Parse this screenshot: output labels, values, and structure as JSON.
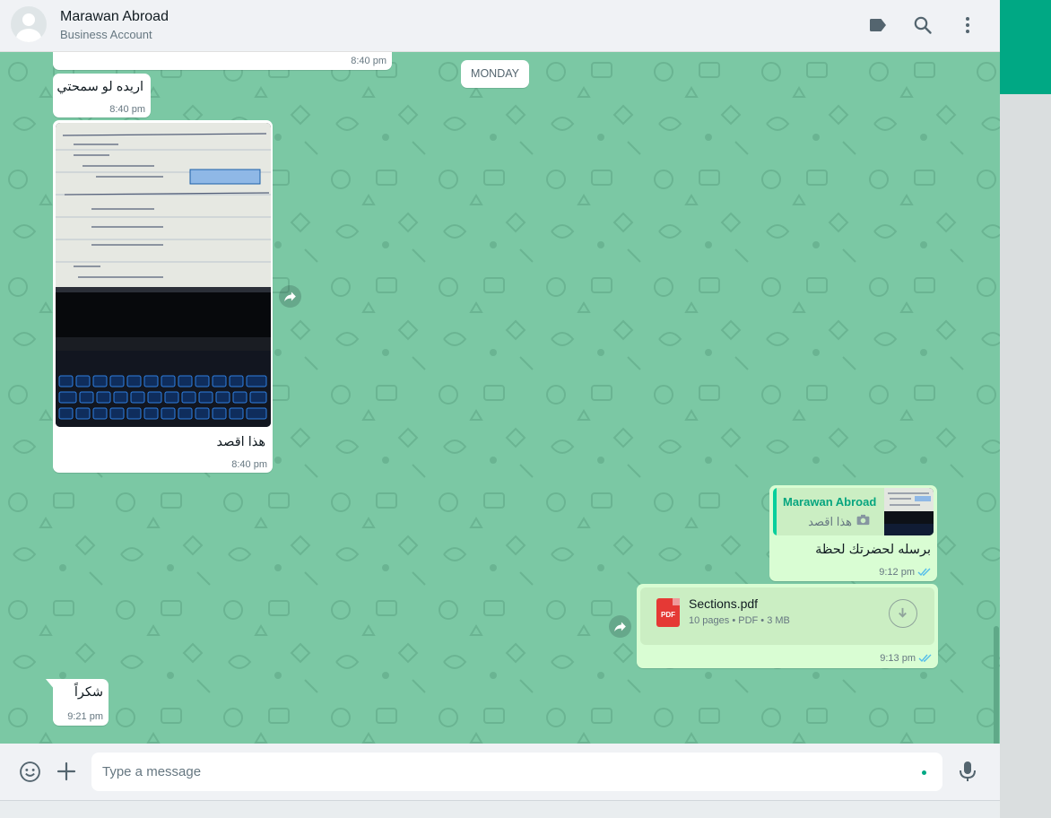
{
  "header": {
    "contact_name": "Marawan Abroad",
    "contact_subtitle": "Business Account",
    "icons": [
      "label-icon",
      "search-icon",
      "menu-icon"
    ]
  },
  "chat": {
    "day_separator": "MONDAY",
    "messages": [
      {
        "direction": "incoming",
        "type": "text",
        "text": "",
        "time": "8:40 pm"
      },
      {
        "direction": "incoming",
        "type": "text",
        "text": "اريده لو سمحتي",
        "time": "8:40 pm"
      },
      {
        "direction": "incoming",
        "type": "image",
        "caption": "هذا اقصد",
        "time": "8:40 pm"
      },
      {
        "direction": "outgoing",
        "type": "reply",
        "quoted_author": "Marawan Abroad",
        "quoted_text": "هذا اقصد",
        "text": "برسله لحضرتك لحظة",
        "time": "9:12 pm",
        "status": "read"
      },
      {
        "direction": "outgoing",
        "type": "document",
        "file_name": "Sections.pdf",
        "file_icon_label": "PDF",
        "file_meta": "10 pages • PDF • 3 MB",
        "time": "9:13 pm",
        "status": "read"
      },
      {
        "direction": "incoming",
        "type": "text",
        "text": "شكراً",
        "time": "9:21 pm"
      }
    ]
  },
  "composer": {
    "placeholder": "Type a message"
  },
  "colors": {
    "chat_background": "#7bc8a4",
    "incoming_bubble": "#ffffff",
    "outgoing_bubble": "#d9fdd3",
    "accent": "#00a884",
    "read_ticks": "#53bdeb"
  }
}
